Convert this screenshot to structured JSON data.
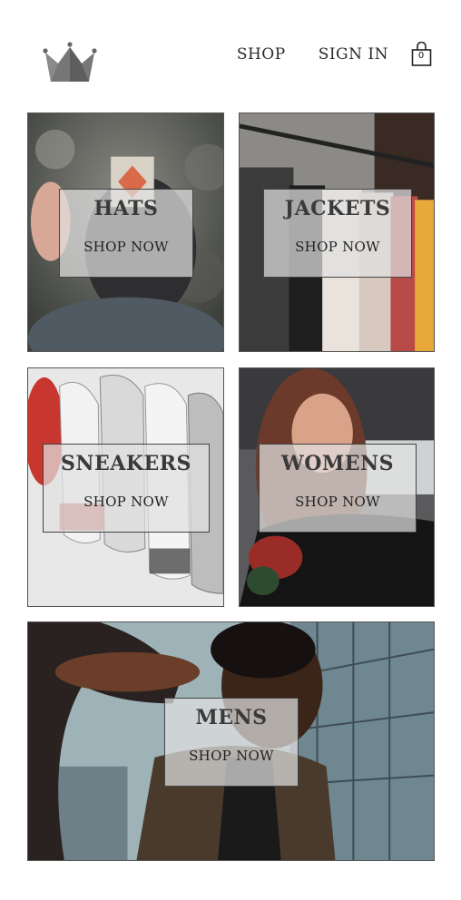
{
  "header": {
    "nav": [
      {
        "label": "SHOP"
      },
      {
        "label": "SIGN IN"
      }
    ],
    "cart_count": "0"
  },
  "categories": [
    {
      "title": "HATS",
      "cta": "SHOP NOW"
    },
    {
      "title": "JACKETS",
      "cta": "SHOP NOW"
    },
    {
      "title": "SNEAKERS",
      "cta": "SHOP NOW"
    },
    {
      "title": "WOMENS",
      "cta": "SHOP NOW"
    },
    {
      "title": "MENS",
      "cta": "SHOP NOW"
    }
  ],
  "colors": {
    "text": "#2a2a2a",
    "overlay": "#e1e1e1",
    "crown": "#5a5a5a"
  },
  "icons": [
    "crown-logo-icon",
    "shopping-bag-icon"
  ]
}
